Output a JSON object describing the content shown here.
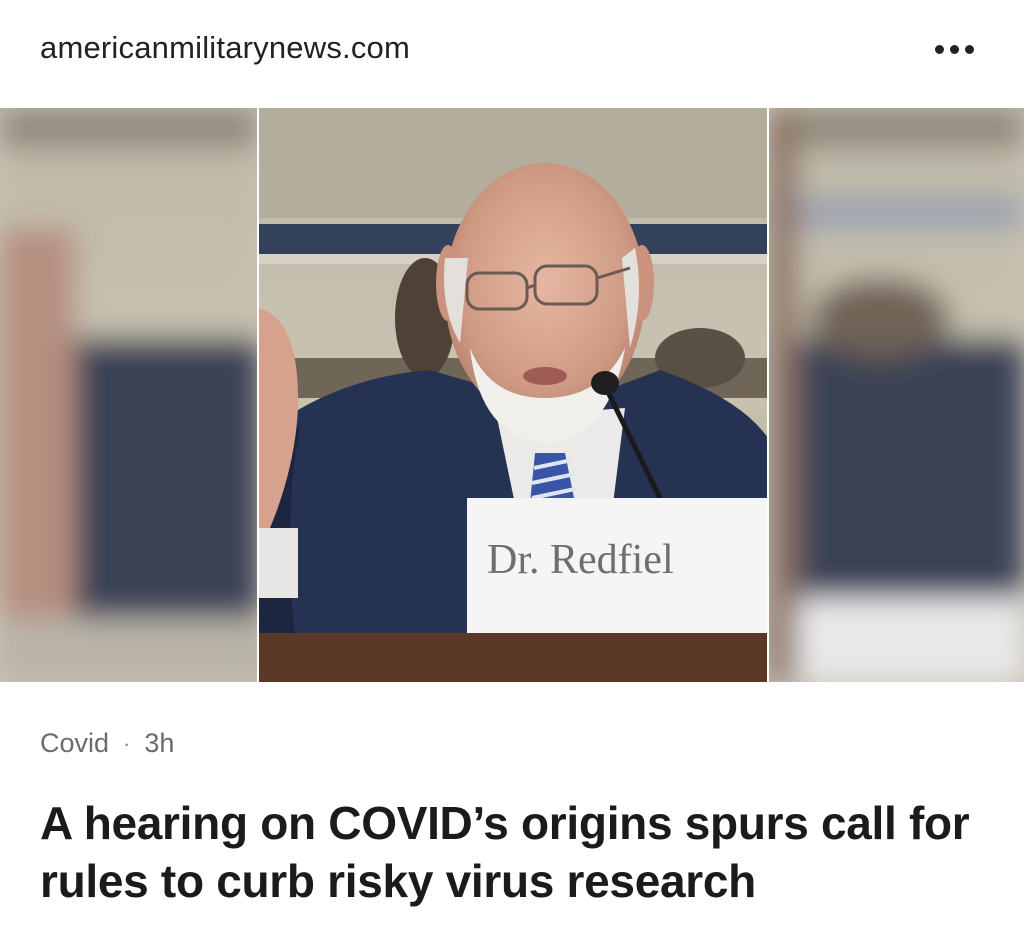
{
  "header": {
    "source": "americanmilitarynews.com",
    "more_icon": "more-horizontal-icon"
  },
  "hero": {
    "nameplate_text": "Dr. Redfiel"
  },
  "article": {
    "category": "Covid",
    "separator": "·",
    "age": "3h",
    "headline": "A hearing on COVID’s origins spurs call for rules to curb risky virus research"
  }
}
